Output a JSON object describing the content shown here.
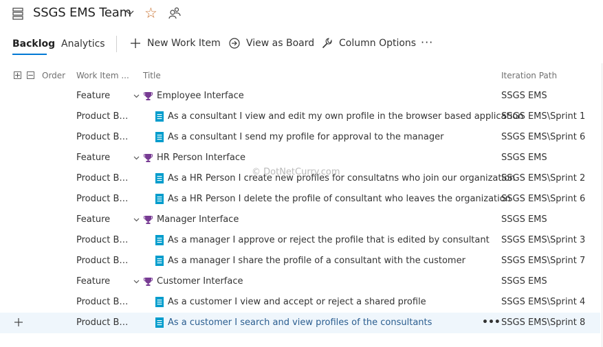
{
  "header": {
    "team_name": "SSGS EMS Team"
  },
  "toolbar": {
    "tabs": [
      {
        "label": "Backlog",
        "active": true
      },
      {
        "label": "Analytics",
        "active": false
      }
    ],
    "new_work_item": "New Work Item",
    "view_as_board": "View as Board",
    "column_options": "Column Options",
    "more": "···"
  },
  "columns": {
    "order": "Order",
    "work_item_type": "Work Item ...",
    "title": "Title",
    "iteration_path": "Iteration Path"
  },
  "rows": [
    {
      "kind": "feature",
      "type": "Feature",
      "title": "Employee Interface",
      "path": "SSGS EMS"
    },
    {
      "kind": "story",
      "type": "Product Ba...",
      "title": "As a consultant I view and edit my own profile in the browser based application",
      "path": "SSGS EMS\\Sprint 1"
    },
    {
      "kind": "story",
      "type": "Product Ba...",
      "title": "As a consultant I send my profile for approval to the manager",
      "path": "SSGS EMS\\Sprint 6"
    },
    {
      "kind": "feature",
      "type": "Feature",
      "title": "HR Person Interface",
      "path": "SSGS EMS"
    },
    {
      "kind": "story",
      "type": "Product Ba...",
      "title": "As a HR Person I create new profiles for consultatns who join our organization",
      "path": "SSGS EMS\\Sprint 2"
    },
    {
      "kind": "story",
      "type": "Product Ba...",
      "title": "As a HR Person I delete the profile of consultant who leaves the organization",
      "path": "SSGS EMS\\Sprint 6"
    },
    {
      "kind": "feature",
      "type": "Feature",
      "title": "Manager Interface",
      "path": "SSGS EMS"
    },
    {
      "kind": "story",
      "type": "Product Ba...",
      "title": "As a manager I approve or reject the profile that is edited by consultant",
      "path": "SSGS EMS\\Sprint 3"
    },
    {
      "kind": "story",
      "type": "Product Ba...",
      "title": "As a manager I share the profile of a consultant with the customer",
      "path": "SSGS EMS\\Sprint 7"
    },
    {
      "kind": "feature",
      "type": "Feature",
      "title": "Customer Interface",
      "path": "SSGS EMS"
    },
    {
      "kind": "story",
      "type": "Product Ba...",
      "title": "As a customer I view and accept or reject a shared profile",
      "path": "SSGS EMS\\Sprint 4"
    },
    {
      "kind": "story",
      "type": "Product Ba...",
      "title": "As a customer I search and view profiles of the consultants",
      "path": "SSGS EMS\\Sprint 8",
      "selected": true
    }
  ],
  "row_more": "•••",
  "watermark": "© DotNetCurry.com",
  "colors": {
    "accent": "#0078d4",
    "feature_icon": "#773b93",
    "story_icon": "#009ccc",
    "selected_row": "#eff6fc"
  }
}
